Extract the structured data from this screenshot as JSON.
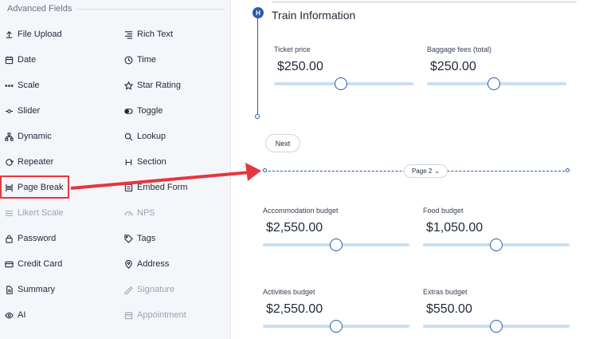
{
  "sidebar": {
    "title": "Advanced Fields",
    "left_fields": [
      {
        "label": "File Upload",
        "icon": "upload-icon",
        "disabled": false
      },
      {
        "label": "Date",
        "icon": "calendar-icon",
        "disabled": false
      },
      {
        "label": "Scale",
        "icon": "scale-icon",
        "disabled": false
      },
      {
        "label": "Slider",
        "icon": "slider-icon",
        "disabled": false
      },
      {
        "label": "Dynamic",
        "icon": "dynamic-icon",
        "disabled": false
      },
      {
        "label": "Repeater",
        "icon": "repeater-icon",
        "disabled": false
      },
      {
        "label": "Page Break",
        "icon": "page-break-icon",
        "disabled": false
      },
      {
        "label": "Likert Scale",
        "icon": "likert-icon",
        "disabled": true
      },
      {
        "label": "Password",
        "icon": "lock-icon",
        "disabled": false
      },
      {
        "label": "Credit Card",
        "icon": "credit-card-icon",
        "disabled": false
      },
      {
        "label": "Summary",
        "icon": "summary-icon",
        "disabled": false
      },
      {
        "label": "AI",
        "icon": "eye-icon",
        "disabled": false
      }
    ],
    "right_fields": [
      {
        "label": "Rich Text",
        "icon": "rich-text-icon",
        "disabled": false
      },
      {
        "label": "Time",
        "icon": "clock-icon",
        "disabled": false
      },
      {
        "label": "Star Rating",
        "icon": "star-icon",
        "disabled": false
      },
      {
        "label": "Toggle",
        "icon": "toggle-icon",
        "disabled": false
      },
      {
        "label": "Lookup",
        "icon": "search-icon",
        "disabled": false
      },
      {
        "label": "Section",
        "icon": "heading-icon",
        "disabled": false
      },
      {
        "label": "Embed Form",
        "icon": "embed-icon",
        "disabled": false
      },
      {
        "label": "NPS",
        "icon": "nps-icon",
        "disabled": true
      },
      {
        "label": "Tags",
        "icon": "tag-icon",
        "disabled": false
      },
      {
        "label": "Address",
        "icon": "location-icon",
        "disabled": false
      },
      {
        "label": "Signature",
        "icon": "signature-icon",
        "disabled": true
      },
      {
        "label": "Appointment",
        "icon": "appointment-icon",
        "disabled": true
      }
    ]
  },
  "main": {
    "section_badge": "H",
    "section_title": "Train Information",
    "page1_fields": [
      {
        "label": "Ticket price",
        "value": "$250.00",
        "thumb": 0.48
      },
      {
        "label": "Baggage fees (total)",
        "value": "$250.00",
        "thumb": 0.48
      }
    ],
    "next_label": "Next",
    "page_break_label": "Page 2",
    "page2_fields": [
      {
        "label": "Accommodation budget",
        "value": "$2,550.00",
        "thumb": 0.5
      },
      {
        "label": "Food budget",
        "value": "$1,050.00",
        "thumb": 0.5
      },
      {
        "label": "Activities budget",
        "value": "$2,550.00",
        "thumb": 0.5
      },
      {
        "label": "Extras budget",
        "value": "$550.00",
        "thumb": 0.5
      }
    ]
  },
  "colors": {
    "accent": "#2a5ca8",
    "highlight": "#e5363f",
    "track": "#c9def2"
  }
}
